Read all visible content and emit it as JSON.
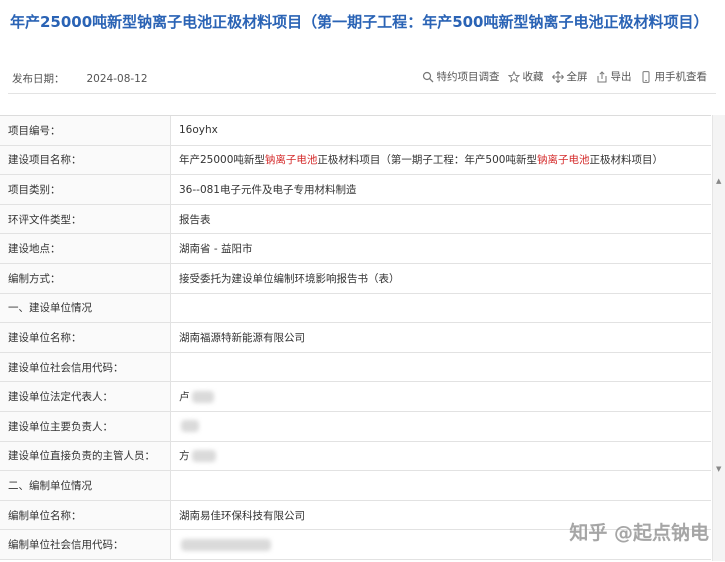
{
  "project": {
    "title": "年产25000吨新型钠离子电池正极材料项目（第一期子工程：年产500吨新型钠离子电池正极材料项目）",
    "publish_label": "发布日期：",
    "publish_date": "2024-08-12"
  },
  "actions": [
    {
      "icon": "search-icon",
      "label": "特约项目调查"
    },
    {
      "icon": "star-icon",
      "label": "收藏"
    },
    {
      "icon": "fullscreen-icon",
      "label": "全屏"
    },
    {
      "icon": "export-icon",
      "label": "导出"
    },
    {
      "icon": "phone-icon",
      "label": "用手机查看"
    }
  ],
  "rows": [
    {
      "key": "项目编号：",
      "value": "16oyhx"
    },
    {
      "key": "建设项目名称：",
      "value_parts": [
        "年产25000吨新型",
        "钠离子电池",
        "正极材料项目（第一期子工程：年产500吨新型",
        "钠离子电池",
        "正极材料项目）"
      ]
    },
    {
      "key": "项目类别：",
      "value": "36--081电子元件及电子专用材料制造"
    },
    {
      "key": "环评文件类型：",
      "value": "报告表"
    },
    {
      "key": "建设地点：",
      "value": "湖南省 - 益阳市"
    },
    {
      "key": "编制方式：",
      "value": "接受委托为建设单位编制环境影响报告书（表）"
    },
    {
      "key": "一、建设单位情况",
      "value": ""
    },
    {
      "key": "建设单位名称：",
      "value": "湖南福源特新能源有限公司"
    },
    {
      "key": "建设单位社会信用代码：",
      "value": ""
    },
    {
      "key": "建设单位法定代表人：",
      "value": "卢"
    },
    {
      "key": "建设单位主要负责人：",
      "value": ""
    },
    {
      "key": "建设单位直接负责的主管人员：",
      "value": "方"
    },
    {
      "key": "二、编制单位情况",
      "value": ""
    },
    {
      "key": "编制单位名称：",
      "value": "湖南易佳环保科技有限公司"
    },
    {
      "key": "编制单位社会信用代码：",
      "value": ""
    }
  ],
  "watermark": "知乎 @起点钠电",
  "colors": {
    "title": "#2a63b5",
    "highlight": "#d42a2a"
  }
}
